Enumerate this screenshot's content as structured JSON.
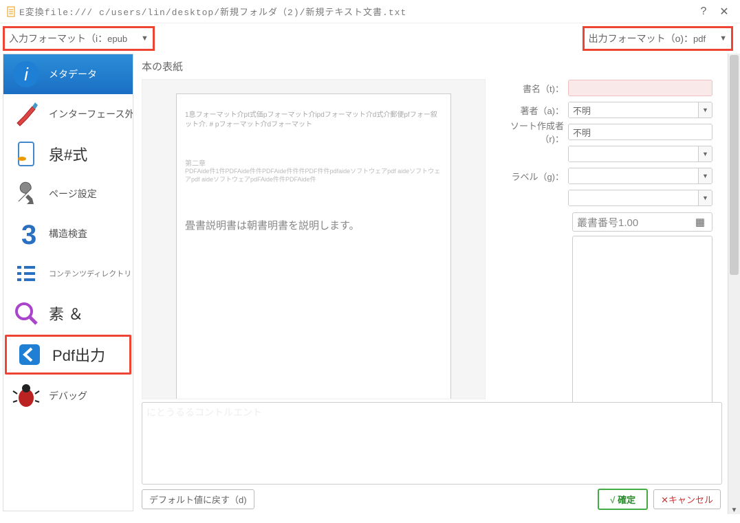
{
  "title": "E変換file:///  c/users/lin/desktop/新規フォルダ（2)/新規テキスト文書.txt",
  "input_format": {
    "label": "入力フォーマット（i：",
    "value": "epub"
  },
  "output_format": {
    "label": "出力フォーマット（o)：",
    "value": "pdf"
  },
  "sidebar": {
    "items": [
      {
        "label": "メタデータ"
      },
      {
        "label": "インターフェース外観"
      },
      {
        "label": "泉#式"
      },
      {
        "label": "ページ設定"
      },
      {
        "label": "構造検査"
      },
      {
        "label": "コンテンツディレクトリ"
      },
      {
        "label": "素 ＆"
      },
      {
        "label": "Pdf出力"
      },
      {
        "label": "デバッグ"
      }
    ]
  },
  "heading": "本の表紙",
  "preview": {
    "line1": "1息フォーマット介pt式価pフォーマット介ipdフォーマット介d式介郵便pfフォー叙ット介. # pフォーマット介dフォーマット",
    "chapter": "第二章",
    "line2a": "PDFAide件1件PDFAide件件PDFAide件件件PDF件件pdfaideソフトウェアpdf aideソフトウェアpdf aideソフトウェアpdFAide件件PDFAide件",
    "big": "畳書説明書は朝書明書を説明します。"
  },
  "fields": {
    "title": {
      "label": "書名（t)：",
      "value": ""
    },
    "author": {
      "label": "著者（a)：",
      "value": "不明"
    },
    "sort": {
      "label": "ソート作成者（r)：",
      "value": "不明"
    },
    "publisher": {
      "label": "",
      "value": ""
    },
    "label": {
      "label": "ラベル（g)：",
      "value": ""
    },
    "blank": {
      "label": "",
      "value": ""
    },
    "series": "叢書番号1.00"
  },
  "lower_ghost": "にとうるるコントルエント",
  "footer": {
    "reset": "デフォルト値に戻す（d)",
    "ok": "確定",
    "cancel": "キャンセル"
  }
}
